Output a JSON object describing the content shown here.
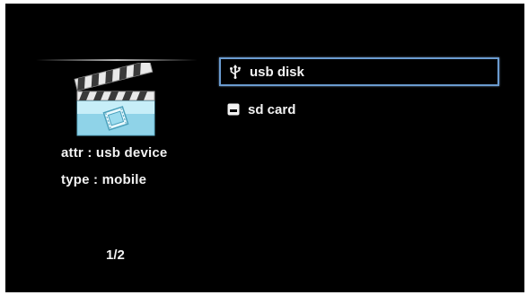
{
  "left_panel": {
    "icon": "clapperboard-icon",
    "attr_text": "attr : usb device",
    "type_text": "type : mobile",
    "page_indicator": "1/2"
  },
  "device_list": {
    "items": [
      {
        "label": "usb disk",
        "icon": "usb-icon",
        "selected": true
      },
      {
        "label": "sd card",
        "icon": "sd-card-icon",
        "selected": false
      }
    ]
  },
  "colors": {
    "background": "#000000",
    "text": "#f2f2f2",
    "selection_border": "#6a9bd0",
    "clapper_base": "#8fd3e8"
  }
}
